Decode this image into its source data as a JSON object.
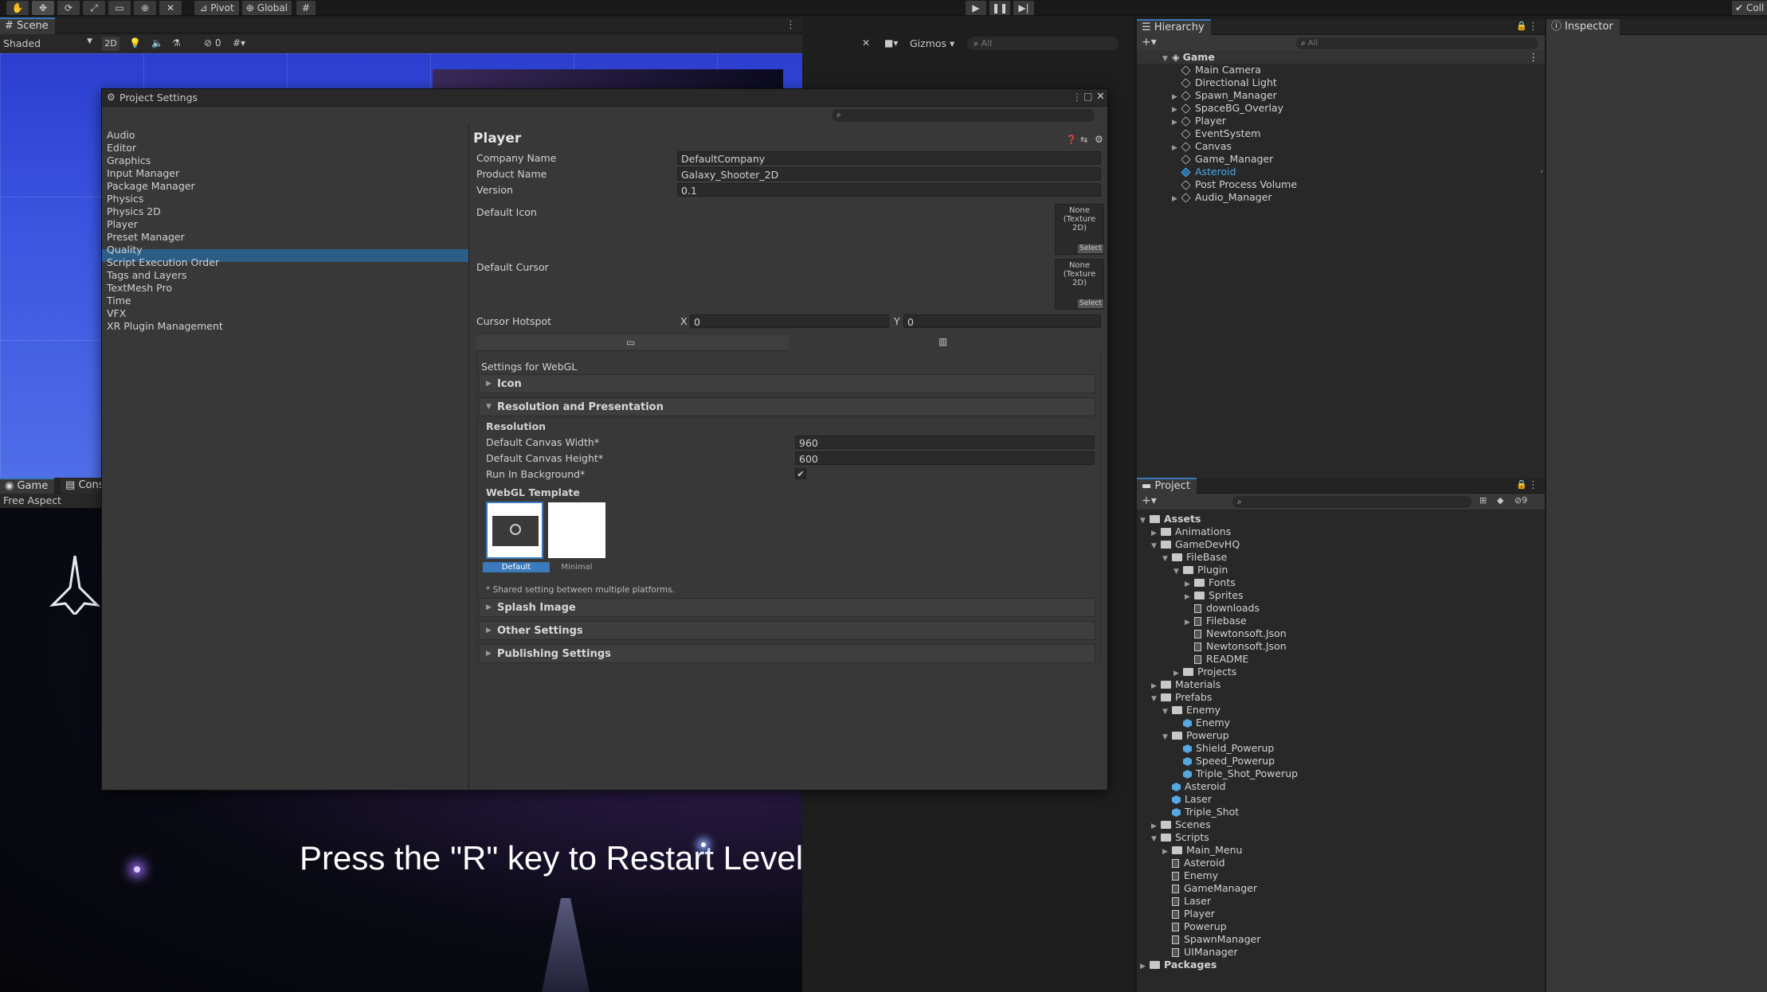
{
  "toolbar": {
    "pivot": "Pivot",
    "global": "Global",
    "collab": "Coll"
  },
  "scene": {
    "tab": "Scene",
    "shading": "Shaded",
    "mode2d": "2D",
    "hidden_count": "0",
    "gizmos": "Gizmos",
    "search_placeholder": "All"
  },
  "game": {
    "tab": "Game",
    "console_tab": "Cons",
    "aspect": "Free Aspect",
    "restart_text": "Press the \"R\" key to Restart Level"
  },
  "dialog": {
    "title": "Project Settings",
    "nav": [
      "Audio",
      "Editor",
      "Graphics",
      "Input Manager",
      "Package Manager",
      "Physics",
      "Physics 2D",
      "Player",
      "Preset Manager",
      "Quality",
      "Script Execution Order",
      "Tags and Layers",
      "TextMesh Pro",
      "Time",
      "VFX",
      "XR Plugin Management"
    ],
    "selected_nav": "Player",
    "heading": "Player",
    "company_label": "Company Name",
    "company_value": "DefaultCompany",
    "product_label": "Product Name",
    "product_value": "Galaxy_Shooter_2D",
    "version_label": "Version",
    "version_value": "0.1",
    "icon_label": "Default Icon",
    "cursor_label": "Default Cursor",
    "none_text": "None",
    "texture_text": "(Texture 2D)",
    "select_text": "Select",
    "hotspot_label": "Cursor Hotspot",
    "x_label": "X",
    "x_value": "0",
    "y_label": "Y",
    "y_value": "0",
    "settings_for": "Settings for WebGL",
    "sections": {
      "icon": "Icon",
      "resolution": "Resolution and Presentation",
      "splash": "Splash Image",
      "other": "Other Settings",
      "publishing": "Publishing Settings"
    },
    "resolution_sub": "Resolution",
    "width_label": "Default Canvas Width*",
    "width_value": "960",
    "height_label": "Default Canvas Height*",
    "height_value": "600",
    "background_label": "Run In Background*",
    "background_checked": true,
    "template_label": "WebGL Template",
    "template_default": "Default",
    "template_minimal": "Minimal",
    "shared_note": "* Shared setting between multiple platforms."
  },
  "hierarchy": {
    "tab": "Hierarchy",
    "search_placeholder": "All",
    "scene_name": "Game",
    "items": [
      {
        "name": "Main Camera",
        "expandable": false,
        "prefab": false
      },
      {
        "name": "Directional Light",
        "expandable": false,
        "prefab": false
      },
      {
        "name": "Spawn_Manager",
        "expandable": true,
        "prefab": false
      },
      {
        "name": "SpaceBG_Overlay",
        "expandable": true,
        "prefab": false
      },
      {
        "name": "Player",
        "expandable": true,
        "prefab": false
      },
      {
        "name": "EventSystem",
        "expandable": false,
        "prefab": false
      },
      {
        "name": "Canvas",
        "expandable": true,
        "prefab": false
      },
      {
        "name": "Game_Manager",
        "expandable": false,
        "prefab": false
      },
      {
        "name": "Asteroid",
        "expandable": false,
        "prefab": true
      },
      {
        "name": "Post Process Volume",
        "expandable": false,
        "prefab": false
      },
      {
        "name": "Audio_Manager",
        "expandable": true,
        "prefab": false
      }
    ]
  },
  "inspector": {
    "tab": "Inspector"
  },
  "project": {
    "tab": "Project",
    "hidden_count": "9",
    "tree": [
      {
        "name": "Assets",
        "depth": 0,
        "type": "folder",
        "exp": "open",
        "bold": true
      },
      {
        "name": "Animations",
        "depth": 1,
        "type": "folder",
        "exp": "closed"
      },
      {
        "name": "GameDevHQ",
        "depth": 1,
        "type": "folder",
        "exp": "open"
      },
      {
        "name": "FileBase",
        "depth": 2,
        "type": "folder",
        "exp": "open"
      },
      {
        "name": "Plugin",
        "depth": 3,
        "type": "folder",
        "exp": "open"
      },
      {
        "name": "Fonts",
        "depth": 4,
        "type": "folder",
        "exp": "closed"
      },
      {
        "name": "Sprites",
        "depth": 4,
        "type": "folder",
        "exp": "closed"
      },
      {
        "name": "downloads",
        "depth": 4,
        "type": "file",
        "exp": "none"
      },
      {
        "name": "Filebase",
        "depth": 4,
        "type": "file",
        "exp": "closed"
      },
      {
        "name": "Newtonsoft.Json",
        "depth": 4,
        "type": "file",
        "exp": "none"
      },
      {
        "name": "Newtonsoft.Json",
        "depth": 4,
        "type": "file",
        "exp": "none"
      },
      {
        "name": "README",
        "depth": 4,
        "type": "file",
        "exp": "none"
      },
      {
        "name": "Projects",
        "depth": 3,
        "type": "folder",
        "exp": "closed"
      },
      {
        "name": "Materials",
        "depth": 1,
        "type": "folder",
        "exp": "closed"
      },
      {
        "name": "Prefabs",
        "depth": 1,
        "type": "folder",
        "exp": "open"
      },
      {
        "name": "Enemy",
        "depth": 2,
        "type": "folder",
        "exp": "open"
      },
      {
        "name": "Enemy",
        "depth": 3,
        "type": "prefab",
        "exp": "none"
      },
      {
        "name": "Powerup",
        "depth": 2,
        "type": "folder",
        "exp": "open"
      },
      {
        "name": "Shield_Powerup",
        "depth": 3,
        "type": "prefab",
        "exp": "none"
      },
      {
        "name": "Speed_Powerup",
        "depth": 3,
        "type": "prefab",
        "exp": "none"
      },
      {
        "name": "Triple_Shot_Powerup",
        "depth": 3,
        "type": "prefab",
        "exp": "none"
      },
      {
        "name": "Asteroid",
        "depth": 2,
        "type": "prefab",
        "exp": "none"
      },
      {
        "name": "Laser",
        "depth": 2,
        "type": "prefab",
        "exp": "none"
      },
      {
        "name": "Triple_Shot",
        "depth": 2,
        "type": "prefab",
        "exp": "none"
      },
      {
        "name": "Scenes",
        "depth": 1,
        "type": "folder",
        "exp": "closed"
      },
      {
        "name": "Scripts",
        "depth": 1,
        "type": "folder",
        "exp": "open"
      },
      {
        "name": "Main_Menu",
        "depth": 2,
        "type": "folder",
        "exp": "closed"
      },
      {
        "name": "Asteroid",
        "depth": 2,
        "type": "script",
        "exp": "none"
      },
      {
        "name": "Enemy",
        "depth": 2,
        "type": "script",
        "exp": "none"
      },
      {
        "name": "GameManager",
        "depth": 2,
        "type": "script",
        "exp": "none"
      },
      {
        "name": "Laser",
        "depth": 2,
        "type": "script",
        "exp": "none"
      },
      {
        "name": "Player",
        "depth": 2,
        "type": "script",
        "exp": "none"
      },
      {
        "name": "Powerup",
        "depth": 2,
        "type": "script",
        "exp": "none"
      },
      {
        "name": "SpawnManager",
        "depth": 2,
        "type": "script",
        "exp": "none"
      },
      {
        "name": "UIManager",
        "depth": 2,
        "type": "script",
        "exp": "none"
      },
      {
        "name": "Packages",
        "depth": 0,
        "type": "folder",
        "exp": "closed",
        "bold": true
      }
    ]
  },
  "colors": {
    "accent": "#3a79bb",
    "selection": "#2c5d87",
    "prefab": "#4aa8e8"
  }
}
